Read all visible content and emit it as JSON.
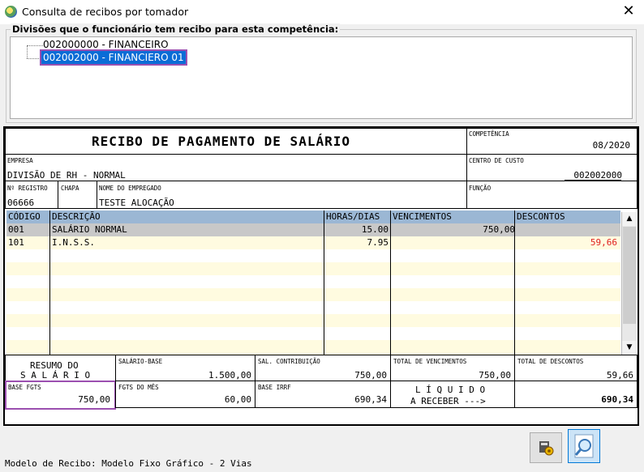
{
  "window": {
    "title": "Consulta de recibos por tomador"
  },
  "divisions": {
    "legend": "Divisões que o funcionário tem recibo para esta competência:",
    "items": [
      {
        "label": "002000000 - FINANCEIRO"
      },
      {
        "label": "002002000 - FINANCIERO 01"
      }
    ]
  },
  "receipt": {
    "title": "RECIBO DE PAGAMENTO DE SALÁRIO",
    "competencia_label": "COMPETÊNCIA",
    "competencia": "08/2020",
    "empresa_label": "EMPRESA",
    "empresa": "DIVISÃO DE RH - NORMAL",
    "centro_label": "CENTRO DE CUSTO",
    "centro": "002002000",
    "registro_label": "Nº REGISTRO",
    "registro": "06666",
    "chapa_label": "CHAPA",
    "nome_label": "NOME DO EMPREGADO",
    "nome": "TESTE ALOCAÇÃO",
    "funcao_label": "FUNÇÃO",
    "table": {
      "headers": [
        "CÓDIGO",
        "DESCRIÇÃO",
        "HORAS/DIAS",
        "VENCIMENTOS",
        "DESCONTOS"
      ],
      "rows": [
        {
          "codigo": "001",
          "descricao": "SALÁRIO NORMAL",
          "horas": "15.00",
          "vencimentos": "750,00",
          "descontos": ""
        },
        {
          "codigo": "101",
          "descricao": "I.N.S.S.",
          "horas": "7.95",
          "vencimentos": "",
          "descontos": "59,66"
        }
      ]
    },
    "resumo_line1": "RESUMO DO",
    "resumo_line2": "S A L Á R I O",
    "salario_base_label": "SALÁRIO-BASE",
    "salario_base": "1.500,00",
    "sal_contrib_label": "SAL. CONTRIBUIÇÃO",
    "sal_contrib": "750,00",
    "total_venc_label": "TOTAL DE VENCIMENTOS",
    "total_venc": "750,00",
    "total_desc_label": "TOTAL DE DESCONTOS",
    "total_desc": "59,66",
    "base_fgts_label": "BASE FGTS",
    "base_fgts": "750,00",
    "fgts_mes_label": "FGTS DO MÊS",
    "fgts_mes": "60,00",
    "base_irrf_label": "BASE IRRF",
    "base_irrf": "690,34",
    "liquido_line1": "L Í Q U I D O",
    "liquido_line2": "A RECEBER --->",
    "liquido": "690,34"
  },
  "status": {
    "text": "Modelo de Recibo: Modelo Fixo Gráfico - 2 Vias"
  },
  "colors": {
    "header_bg": "#9bb7d4",
    "row_alt": "#fffbe0",
    "row_sel": "#c8c8c8",
    "discount": "#e0201e",
    "highlight": "#9b4fb0"
  }
}
